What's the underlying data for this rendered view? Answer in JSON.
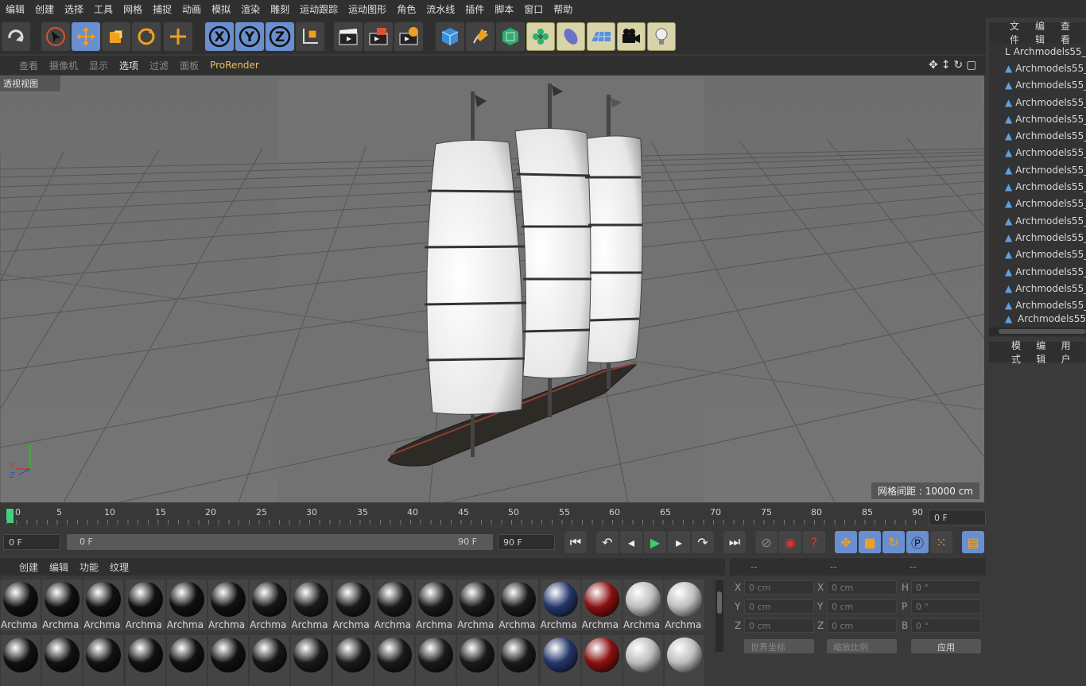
{
  "menu": [
    "编辑",
    "创建",
    "选择",
    "工具",
    "网格",
    "捕捉",
    "动画",
    "模拟",
    "渲染",
    "雕刻",
    "运动跟踪",
    "运动图形",
    "角色",
    "流水线",
    "插件",
    "脚本",
    "窗口",
    "帮助"
  ],
  "toolbar": {
    "undo": "undo-icon",
    "axes": [
      "X",
      "Y",
      "Z"
    ],
    "accent": "#f0a020",
    "select_color": "#6a8fd0"
  },
  "viewport_menu": [
    "查看",
    "摄像机",
    "显示",
    "选项",
    "过滤",
    "面板",
    "ProRender"
  ],
  "viewport": {
    "label": "透视视图",
    "grid_info": "网格间距 : 10000 cm",
    "axis_labels": [
      "Y",
      "X",
      "Z"
    ]
  },
  "object_manager": {
    "tabs": [
      "文件",
      "编辑",
      "查看"
    ],
    "items": [
      "Archmodels55_",
      "Archmodels55_",
      "Archmodels55_",
      "Archmodels55_",
      "Archmodels55_",
      "Archmodels55_",
      "Archmodels55_",
      "Archmodels55_",
      "Archmodels55_",
      "Archmodels55_",
      "Archmodels55_",
      "Archmodels55_",
      "Archmodels55_",
      "Archmodels55_",
      "Archmodels55_",
      "Archmodels55_",
      "Archmodels55"
    ]
  },
  "attribute_manager": {
    "tabs": [
      "模式",
      "编辑",
      "用户"
    ]
  },
  "timeline": {
    "ticks": [
      "0",
      "5",
      "10",
      "15",
      "20",
      "25",
      "30",
      "35",
      "40",
      "45",
      "50",
      "55",
      "60",
      "65",
      "70",
      "75",
      "80",
      "85",
      "90"
    ],
    "frame_indicator": "0 F"
  },
  "transport": {
    "start_field": "0 F",
    "range_start": "0 F",
    "range_end": "90 F",
    "end_field": "90 F"
  },
  "material_manager": {
    "tabs": [
      "创建",
      "编辑",
      "功能",
      "纹理"
    ],
    "label": "Archma",
    "materials": [
      {
        "color": "#111111"
      },
      {
        "color": "#111111"
      },
      {
        "color": "#111111"
      },
      {
        "color": "#111111"
      },
      {
        "color": "#111111"
      },
      {
        "color": "#111111"
      },
      {
        "color": "#161616"
      },
      {
        "color": "#1a1a1a"
      },
      {
        "color": "#1a1a1a"
      },
      {
        "color": "#1a1a1a"
      },
      {
        "color": "#1a1a1a"
      },
      {
        "color": "#1a1a1a"
      },
      {
        "color": "#1a1a1a"
      },
      {
        "color": "#24366a"
      },
      {
        "color": "#8a1010"
      },
      {
        "color": "#bdbdbd"
      },
      {
        "color": "#bdbdbd"
      }
    ]
  },
  "coordinates": {
    "headers": [
      "--",
      "--",
      "--"
    ],
    "rows": [
      {
        "a": "X",
        "av": "0 cm",
        "b": "X",
        "bv": "0 cm",
        "c": "H",
        "cv": "0 °"
      },
      {
        "a": "Y",
        "av": "0 cm",
        "b": "Y",
        "bv": "0 cm",
        "c": "P",
        "cv": "0 °"
      },
      {
        "a": "Z",
        "av": "0 cm",
        "b": "Z",
        "bv": "0 cm",
        "c": "B",
        "cv": "0 °"
      }
    ],
    "world_label": "世界坐标",
    "scale_label": "缩放比例",
    "apply_label": "应用"
  }
}
